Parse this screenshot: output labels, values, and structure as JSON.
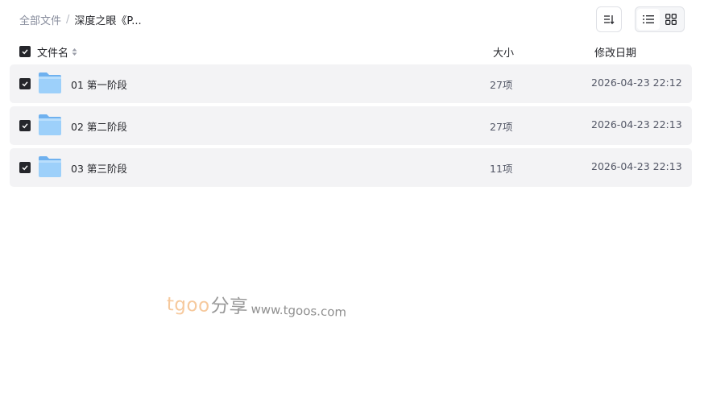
{
  "breadcrumb": {
    "root": "全部文件",
    "separator": "/",
    "current": "深度之眼《P..."
  },
  "toolbar": {
    "sort_icon": "sort-icon",
    "view_modes": [
      {
        "name": "list",
        "icon": "list-view-icon",
        "active": true
      },
      {
        "name": "grid",
        "icon": "grid-view-icon",
        "active": false
      }
    ]
  },
  "list_header": {
    "name": "文件名",
    "size": "大小",
    "modified": "修改日期"
  },
  "files": [
    {
      "name": "01 第一阶段",
      "size": "27项",
      "modified": "2026-04-23 22:12",
      "checked": true
    },
    {
      "name": "02 第二阶段",
      "size": "27项",
      "modified": "2026-04-23 22:13",
      "checked": true
    },
    {
      "name": "03 第三阶段",
      "size": "11项",
      "modified": "2026-04-23 22:13",
      "checked": true
    }
  ],
  "watermark": {
    "brand": "tgoo",
    "suffix": "分享",
    "url": "www.tgoos.com"
  },
  "colors": {
    "row_background": "#f3f3f5",
    "checkbox": "#25262b",
    "folder": "#8ec8f7",
    "watermark_brand": "#f6c99d"
  }
}
